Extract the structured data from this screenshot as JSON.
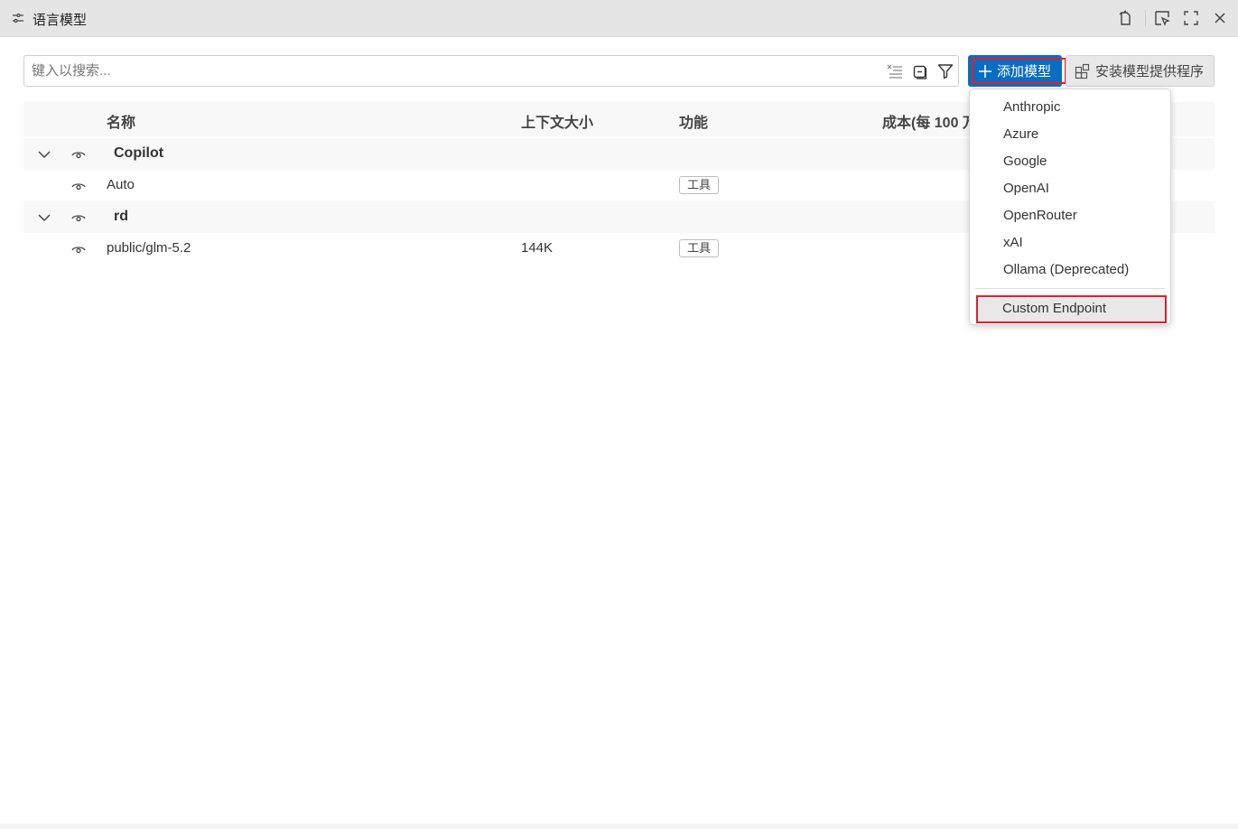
{
  "window": {
    "title": "语言模型"
  },
  "search": {
    "placeholder": "键入以搜索..."
  },
  "toolbar": {
    "add_model_label": "添加模型",
    "install_provider_label": "安装模型提供程序"
  },
  "table": {
    "headers": [
      "名称",
      "上下文大小",
      "功能",
      "成本(每 100 万"
    ],
    "groups": [
      {
        "name": "Copilot",
        "rows": [
          {
            "name": "Auto",
            "context": "",
            "capability": "工具"
          }
        ]
      },
      {
        "name": "rd",
        "rows": [
          {
            "name": "public/glm-5.2",
            "context": "144K",
            "capability": "工具"
          }
        ]
      }
    ]
  },
  "dropdown": {
    "items": [
      "Anthropic",
      "Azure",
      "Google",
      "OpenAI",
      "OpenRouter",
      "xAI",
      "Ollama (Deprecated)"
    ],
    "custom_item": "Custom Endpoint"
  },
  "colors": {
    "accent": "#0b6dc1",
    "highlight": "#e0202a",
    "titlebar": "#e5e5e5"
  },
  "icons": [
    "settings-sliders-icon",
    "attach-icon",
    "select-element-icon",
    "fullscreen-icon",
    "close-icon",
    "clear-filter-icon",
    "collapse-icon",
    "filter-icon",
    "plus-icon",
    "extensions-icon",
    "chevron-down-icon",
    "eye-icon"
  ]
}
